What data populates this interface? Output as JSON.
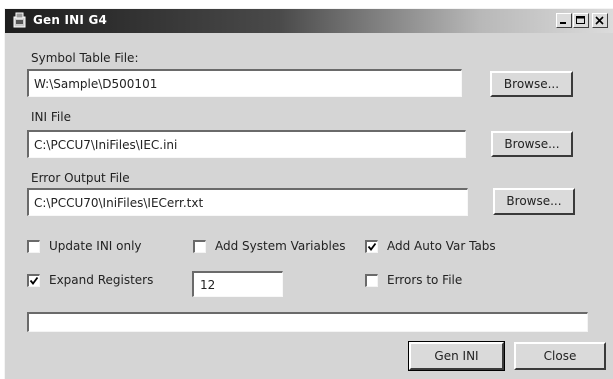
{
  "window": {
    "title": "Gen INI G4",
    "icon": "app-icon"
  },
  "symbol_table": {
    "label": "Symbol Table File:",
    "value": "W:\\Sample\\D500101",
    "browse_label": "Browse..."
  },
  "ini_file": {
    "label": "INI File",
    "value": "C:\\PCCU7\\IniFiles\\IEC.ini",
    "browse_label": "Browse..."
  },
  "error_output": {
    "label": "Error Output File",
    "value": "C:\\PCCU70\\IniFiles\\IECerr.txt",
    "browse_label": "Browse..."
  },
  "options": {
    "update_ini_only": {
      "label": "Update INI only",
      "checked": false
    },
    "add_system_variables": {
      "label": "Add System Variables",
      "checked": false
    },
    "add_auto_var_tabs": {
      "label": "Add Auto Var Tabs",
      "checked": true
    },
    "expand_registers": {
      "label": "Expand Registers",
      "checked": true
    },
    "errors_to_file": {
      "label": "Errors to File",
      "checked": false
    }
  },
  "registers_count": "12",
  "progress": 0,
  "actions": {
    "gen_ini_label": "Gen INI",
    "close_label": "Close"
  }
}
